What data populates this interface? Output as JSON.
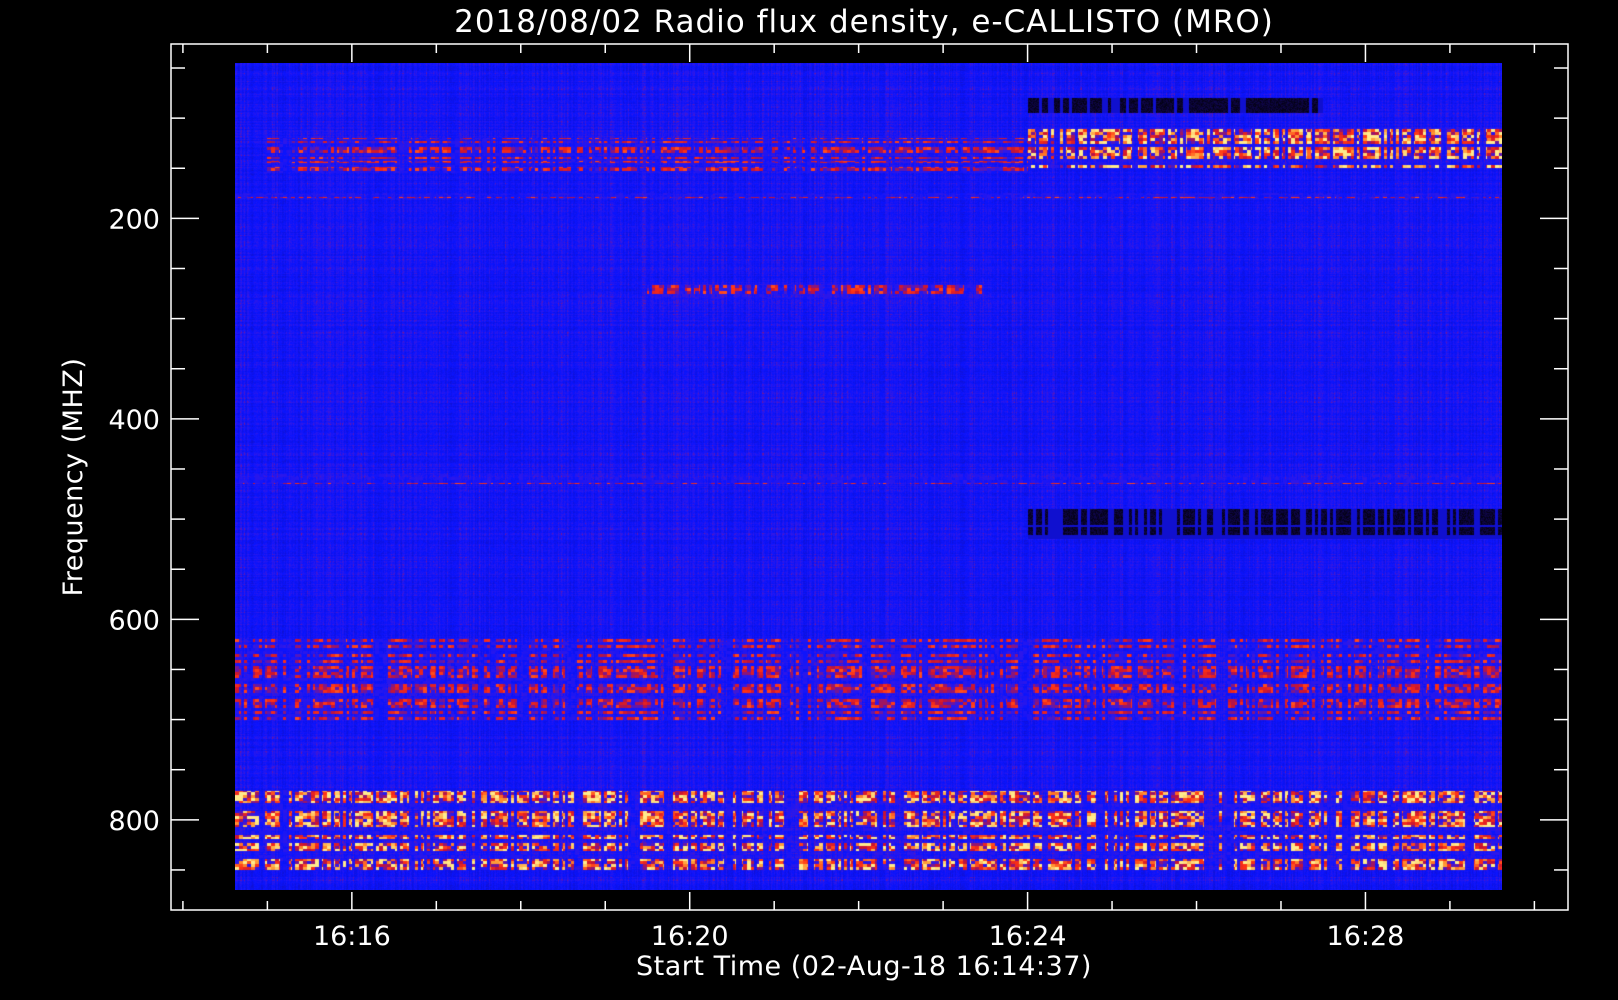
{
  "chart_data": {
    "type": "heatmap",
    "title": "2018/08/02  Radio flux density, e-CALLISTO (MRO)",
    "xlabel": "Start Time (02-Aug-18 16:14:37)",
    "ylabel": "Frequency (MHZ)",
    "x_range": [
      "16:14:37",
      "16:29:37"
    ],
    "y_range_mhz": [
      45,
      870
    ],
    "y_inverted": true,
    "x_ticks": [
      "16:16",
      "16:20",
      "16:24",
      "16:28"
    ],
    "y_ticks": [
      200,
      400,
      600,
      800
    ],
    "colormap": [
      "#000000",
      "#1a0a80",
      "#0a14ff",
      "#3218e6",
      "#c81432",
      "#ff3214",
      "#ff9632",
      "#ffeb8c"
    ],
    "background_color": "#000000",
    "dominant_color": "#0a14ff",
    "features": [
      {
        "label": "intermittent bursts",
        "freq_mhz": [
          120,
          155
        ],
        "time": [
          "16:15",
          "16:24"
        ],
        "intensity": "medium"
      },
      {
        "label": "strong emission band",
        "freq_mhz": [
          110,
          150
        ],
        "time": [
          "16:24",
          "16:29:37"
        ],
        "intensity": "high"
      },
      {
        "label": "dark band",
        "freq_mhz": [
          80,
          95
        ],
        "time": [
          "16:24",
          "16:27:30"
        ],
        "intensity": "low"
      },
      {
        "label": "periodic interference line",
        "freq_mhz": [
          175,
          180
        ],
        "time": [
          "16:14:37",
          "16:29:37"
        ],
        "intensity": "medium"
      },
      {
        "label": "weak band",
        "freq_mhz": [
          265,
          280
        ],
        "time": [
          "16:19:30",
          "16:23:30"
        ],
        "intensity": "medium"
      },
      {
        "label": "interference band",
        "freq_mhz": [
          455,
          465
        ],
        "time": [
          "16:14:37",
          "16:29:37"
        ],
        "intensity": "medium"
      },
      {
        "label": "dark absorption band",
        "freq_mhz": [
          490,
          520
        ],
        "time": [
          "16:24",
          "16:29:37"
        ],
        "intensity": "low"
      },
      {
        "label": "interference bands",
        "freq_mhz": [
          620,
          700
        ],
        "time": [
          "16:14:37",
          "16:29:37"
        ],
        "intensity": "medium"
      },
      {
        "label": "strong interference",
        "freq_mhz": [
          770,
          850
        ],
        "time": [
          "16:14:37",
          "16:29:37"
        ],
        "intensity": "high"
      }
    ]
  }
}
